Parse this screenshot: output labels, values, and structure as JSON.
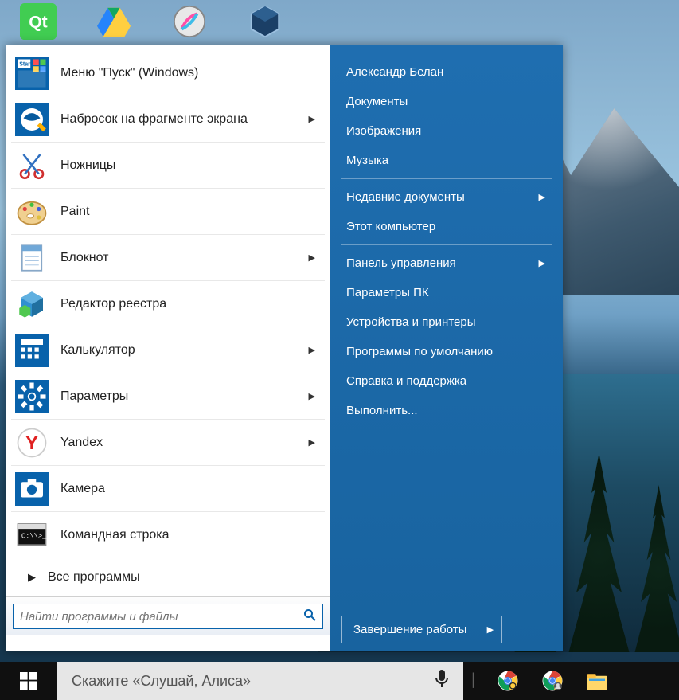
{
  "desktop": {
    "icons": [
      "Qt",
      "Google Drive",
      "Krita",
      "VirtualBox"
    ]
  },
  "startmenu": {
    "left_items": [
      {
        "label": "Меню \"Пуск\" (Windows)",
        "icon": "start-tile-icon",
        "has_submenu": false
      },
      {
        "label": "Набросок на фрагменте экрана",
        "icon": "snip-sketch-icon",
        "has_submenu": true
      },
      {
        "label": "Ножницы",
        "icon": "scissors-icon",
        "has_submenu": false
      },
      {
        "label": "Paint",
        "icon": "paint-icon",
        "has_submenu": false
      },
      {
        "label": "Блокнот",
        "icon": "notepad-icon",
        "has_submenu": true
      },
      {
        "label": "Редактор реестра",
        "icon": "regedit-icon",
        "has_submenu": false
      },
      {
        "label": "Калькулятор",
        "icon": "calculator-icon",
        "has_submenu": true
      },
      {
        "label": "Параметры",
        "icon": "settings-icon",
        "has_submenu": true
      },
      {
        "label": "Yandex",
        "icon": "yandex-icon",
        "has_submenu": true
      },
      {
        "label": "Камера",
        "icon": "camera-icon",
        "has_submenu": false
      },
      {
        "label": "Командная строка",
        "icon": "cmd-icon",
        "has_submenu": false
      }
    ],
    "all_programs": "Все программы",
    "search_placeholder": "Найти программы и файлы",
    "right_items": [
      {
        "label": "Александр Белан",
        "type": "item"
      },
      {
        "label": "Документы",
        "type": "item"
      },
      {
        "label": "Изображения",
        "type": "item"
      },
      {
        "label": "Музыка",
        "type": "item"
      },
      {
        "type": "sep"
      },
      {
        "label": "Недавние документы",
        "type": "item_arrow"
      },
      {
        "label": "Этот компьютер",
        "type": "item"
      },
      {
        "type": "sep"
      },
      {
        "label": "Панель управления",
        "type": "item_arrow"
      },
      {
        "label": "Параметры ПК",
        "type": "item"
      },
      {
        "label": "Устройства и принтеры",
        "type": "item"
      },
      {
        "label": "Программы по умолчанию",
        "type": "item"
      },
      {
        "label": "Справка и поддержка",
        "type": "item"
      },
      {
        "label": "Выполнить...",
        "type": "item"
      }
    ],
    "shutdown_label": "Завершение работы"
  },
  "taskbar": {
    "alice_placeholder": "Скажите «Слушай, Алиса»",
    "pinned": [
      "Chrome",
      "Chrome (profile)",
      "Проводник"
    ]
  },
  "colors": {
    "accent": "#0862ab",
    "startmenu_right": "#1c67a6",
    "taskbar": "#101010"
  }
}
